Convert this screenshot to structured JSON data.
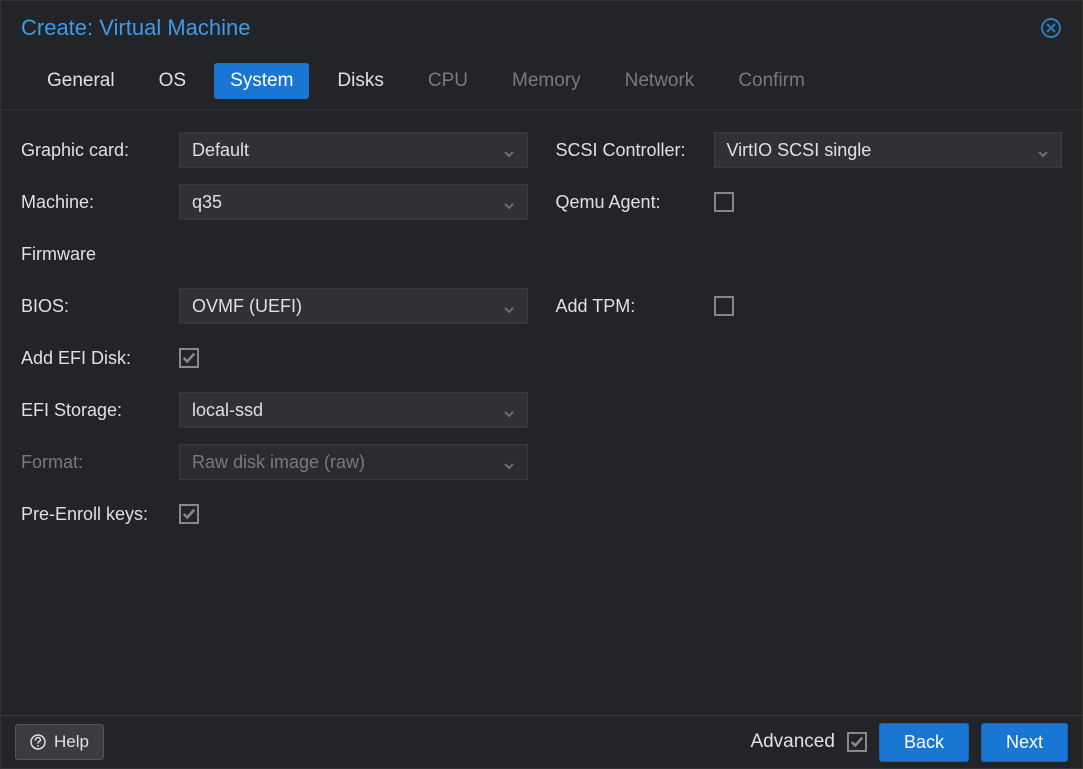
{
  "title": "Create: Virtual Machine",
  "tabs": [
    {
      "label": "General",
      "state": "normal"
    },
    {
      "label": "OS",
      "state": "normal"
    },
    {
      "label": "System",
      "state": "active"
    },
    {
      "label": "Disks",
      "state": "normal"
    },
    {
      "label": "CPU",
      "state": "disabled"
    },
    {
      "label": "Memory",
      "state": "disabled"
    },
    {
      "label": "Network",
      "state": "disabled"
    },
    {
      "label": "Confirm",
      "state": "disabled"
    }
  ],
  "left": {
    "graphic_card": {
      "label": "Graphic card:",
      "value": "Default"
    },
    "machine": {
      "label": "Machine:",
      "value": "q35"
    },
    "firmware_section": "Firmware",
    "bios": {
      "label": "BIOS:",
      "value": "OVMF (UEFI)"
    },
    "add_efi_disk": {
      "label": "Add EFI Disk:",
      "checked": true
    },
    "efi_storage": {
      "label": "EFI Storage:",
      "value": "local-ssd"
    },
    "format": {
      "label": "Format:",
      "value": "Raw disk image (raw)",
      "disabled": true
    },
    "pre_enroll": {
      "label": "Pre-Enroll keys:",
      "checked": true
    }
  },
  "right": {
    "scsi_controller": {
      "label": "SCSI Controller:",
      "value": "VirtIO SCSI single"
    },
    "qemu_agent": {
      "label": "Qemu Agent:",
      "checked": false
    },
    "add_tpm": {
      "label": "Add TPM:",
      "checked": false
    }
  },
  "footer": {
    "help": "Help",
    "advanced": "Advanced",
    "advanced_checked": true,
    "back": "Back",
    "next": "Next"
  }
}
